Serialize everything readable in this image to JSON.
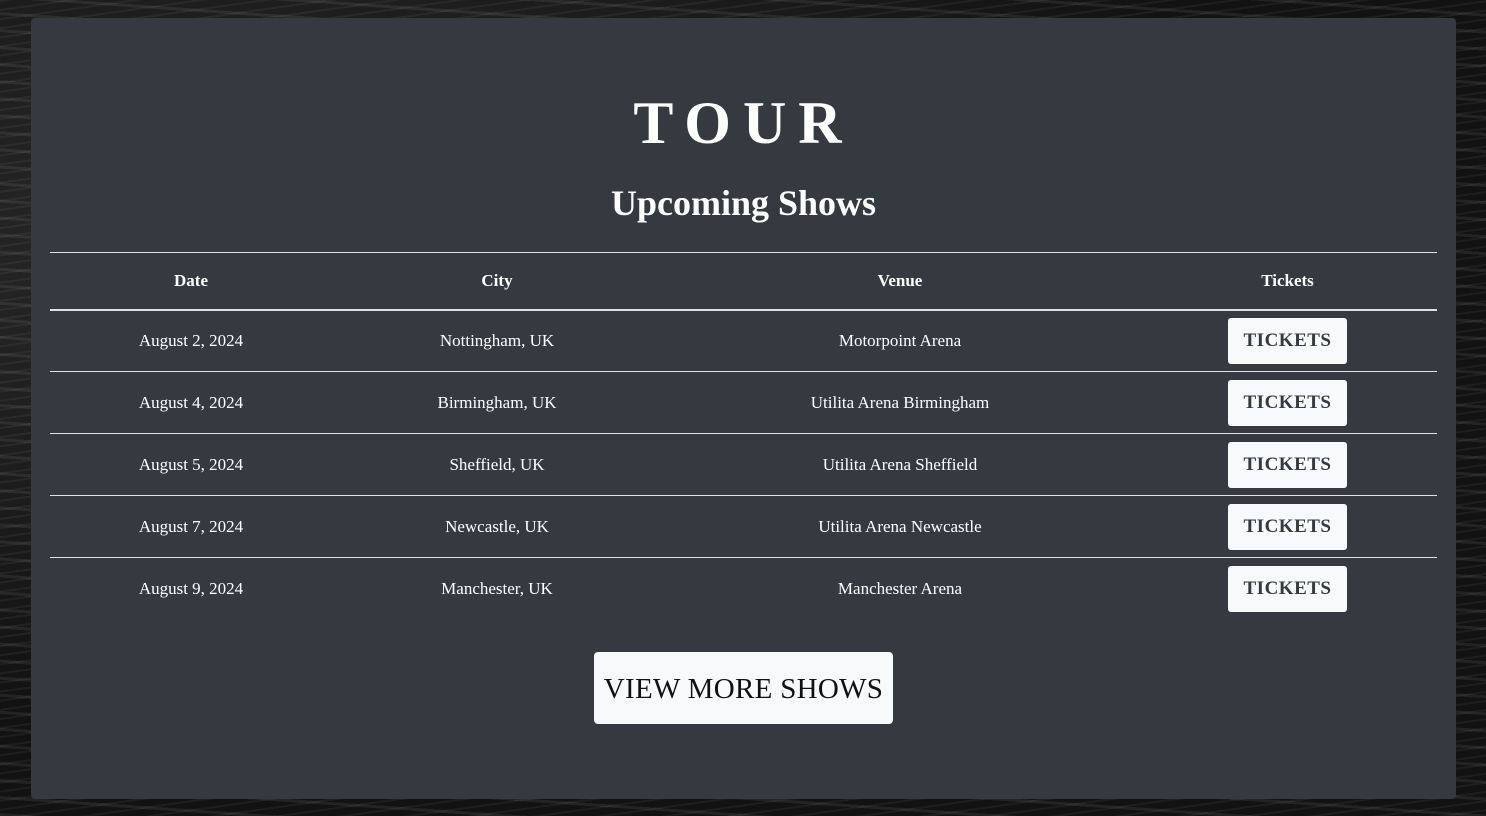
{
  "page": {
    "title": "TOUR",
    "subtitle": "Upcoming Shows"
  },
  "table": {
    "headers": {
      "date": "Date",
      "city": "City",
      "venue": "Venue",
      "tickets": "Tickets"
    },
    "rows": [
      {
        "date": "August 2, 2024",
        "city": "Nottingham, UK",
        "venue": "Motorpoint Arena",
        "button": "TICKETS"
      },
      {
        "date": "August 4, 2024",
        "city": "Birmingham, UK",
        "venue": "Utilita Arena Birmingham",
        "button": "TICKETS"
      },
      {
        "date": "August 5, 2024",
        "city": "Sheffield, UK",
        "venue": "Utilita Arena Sheffield",
        "button": "TICKETS"
      },
      {
        "date": "August 7, 2024",
        "city": "Newcastle, UK",
        "venue": "Utilita Arena Newcastle",
        "button": "TICKETS"
      },
      {
        "date": "August 9, 2024",
        "city": "Manchester, UK",
        "venue": "Manchester Arena",
        "button": "TICKETS"
      }
    ]
  },
  "view_more": {
    "label": "VIEW MORE SHOWS"
  },
  "colors": {
    "panel": "#343a40",
    "button_bg": "#f8f9fa",
    "text": "#ffffff"
  }
}
